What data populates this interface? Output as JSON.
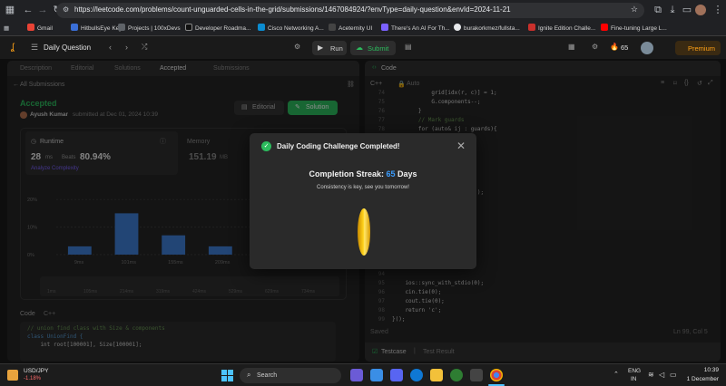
{
  "browser": {
    "url": "https://leetcode.com/problems/count-unguarded-cells-in-the-grid/submissions/1467084924/?envType=daily-question&envId=2024-11-21",
    "bookmarks": [
      "Gmail",
      "HitbullsEye Key",
      "Projects | 100xDevs",
      "Developer Roadma...",
      "Cisco Networking A...",
      "Aceternity UI",
      "There's An AI For Th...",
      "burakorkmez/fullsta...",
      "Ignite Edition Challe...",
      "Fine-tuning Large L..."
    ]
  },
  "header": {
    "daily_question": "Daily Question",
    "run": "Run",
    "submit": "Submit",
    "streak_count": "65",
    "premium": "Premium"
  },
  "left_panel": {
    "tabs": [
      "Description",
      "Editorial",
      "Solutions",
      "Accepted",
      "Submissions"
    ],
    "all_submissions": "All Submissions",
    "status": "Accepted",
    "author": "Ayush Kumar",
    "submitted_at": "submitted at Dec 01, 2024 10:39",
    "editorial_btn": "Editorial",
    "solution_btn": "Solution",
    "runtime_label": "Runtime",
    "runtime_value": "28",
    "runtime_unit": "ms",
    "beats_label": "Beats",
    "beats_value": "80.94%",
    "analyze": "Analyze Complexity",
    "memory_label": "Memory",
    "memory_value": "151.19",
    "memory_unit": "MB",
    "y_ticks": [
      "20%",
      "10%",
      "0%"
    ],
    "x_ticks": [
      "9ms",
      "101ms",
      "155ms",
      "209ms",
      "263ms",
      "317ms"
    ],
    "mini_ticks": [
      "1ms",
      "105ms",
      "214ms",
      "319ms",
      "424ms",
      "529ms",
      "629ms",
      "734ms"
    ],
    "code_tab": "Code",
    "code_lang": "C++",
    "code_lines": [
      "// union find class with Size & components",
      "class UnionFind {",
      "    int root[100001], Size[100001];"
    ]
  },
  "chart_data": {
    "type": "bar",
    "title": "",
    "xlabel": "",
    "ylabel": "",
    "ylim": [
      0,
      25
    ],
    "categories": [
      "9ms",
      "101ms",
      "155ms",
      "209ms",
      "263ms",
      "317ms"
    ],
    "values": [
      3,
      15,
      7,
      3,
      2,
      1
    ]
  },
  "right_panel": {
    "code_tab": "Code",
    "lang": "C++",
    "auto": "Auto",
    "line_numbers": [
      "74",
      "75",
      "76",
      "77",
      "78",
      "79",
      "80",
      "81",
      "82",
      "83",
      "84",
      "85",
      "86",
      "87",
      "88",
      "89",
      "90",
      "91",
      "92",
      "93",
      "94",
      "95",
      "96",
      "97",
      "98",
      "99"
    ],
    "code": [
      "            grid[idx(r, c)] = 1;",
      "            G.components--;",
      "        }",
      "        // Mark guards",
      "        for (auto& ij : guards){",
      "            ... ij[1];",
      "            ... = 1;",
      "",
      "",
      "            // cells to N",
      "            ...rds) {",
      "            ..., c + ij[1]);",
      "            ...);",
      "",
      "            ...ts-1;",
      "",
      "",
      "",
      "",
      "",
      "",
      "    ios::sync_with_stdio(0);",
      "    cin.tie(0);",
      "    cout.tie(0);",
      "    return 'c';",
      "}();"
    ],
    "saved": "Saved",
    "cursor_pos": "Ln 99, Col 5",
    "testcase": "Testcase",
    "test_result": "Test Result"
  },
  "modal": {
    "title": "Daily Coding Challenge Completed!",
    "streak_label": "Completion Streak:",
    "streak_value": "65",
    "streak_unit": "Days",
    "subtitle": "Consistency is key, see you tomorrow!"
  },
  "taskbar": {
    "ticker": "USD/JPY",
    "change": "-1.18%",
    "search": "Search",
    "lang": "ENG",
    "region": "IN",
    "time": "10:39",
    "date": "1 December"
  },
  "colors": {
    "accent_green": "#2cbb5d",
    "accent_blue": "#3b9dff",
    "premium_orange": "#ffa116",
    "bar_blue": "#3f7fd6"
  }
}
